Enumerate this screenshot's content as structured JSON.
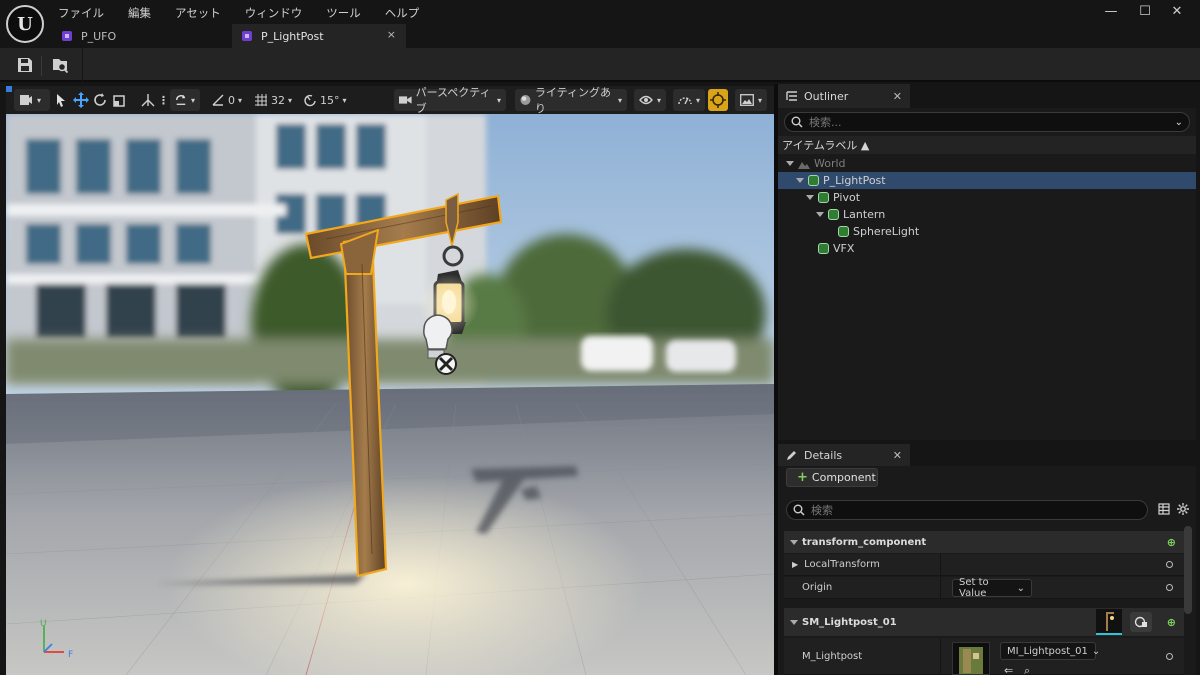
{
  "app": {
    "logo": "U",
    "menu": [
      "ファイル",
      "編集",
      "アセット",
      "ウィンドウ",
      "ツール",
      "ヘルプ"
    ],
    "window_controls": {
      "minimize": "—",
      "maximize": "☐",
      "close": "✕"
    }
  },
  "document_tabs": [
    {
      "label": "P_UFO",
      "active": false
    },
    {
      "label": "P_LightPost",
      "active": true,
      "close": "×"
    }
  ],
  "viewport_toolbar": {
    "snap_angle": "0",
    "grid_size": "32",
    "rotation_snap": "15°",
    "view_mode": "パースペクティブ",
    "lighting_mode": "ライティングあり"
  },
  "axis_gizmo": {
    "z": "U",
    "x": "F"
  },
  "outliner": {
    "tab_label": "Outliner",
    "search_placeholder": "検索...",
    "column_header": "アイテムラベル ▲",
    "items": [
      {
        "label": "World",
        "depth": 0,
        "dimmed": true
      },
      {
        "label": "P_LightPost",
        "depth": 1,
        "selected": true
      },
      {
        "label": "Pivot",
        "depth": 2
      },
      {
        "label": "Lantern",
        "depth": 3
      },
      {
        "label": "SphereLight",
        "depth": 4
      },
      {
        "label": "VFX",
        "depth": 2
      }
    ]
  },
  "details": {
    "tab_label": "Details",
    "add_component_label": "Component",
    "search_placeholder": "検索",
    "sections": {
      "transform": {
        "header": "transform_component",
        "local_transform": "LocalTransform",
        "origin_label": "Origin",
        "origin_value": "Set to Value"
      },
      "mesh": {
        "header": "SM_Lightpost_01",
        "material_label": "M_Lightpost",
        "material_value": "MI_Lightpost_01"
      }
    }
  },
  "colors": {
    "accent_selection": "#304a6e",
    "actor_icon": "#2e7d32",
    "level_icon": "#6f3fd0",
    "outline_select": "#f2a81d"
  }
}
